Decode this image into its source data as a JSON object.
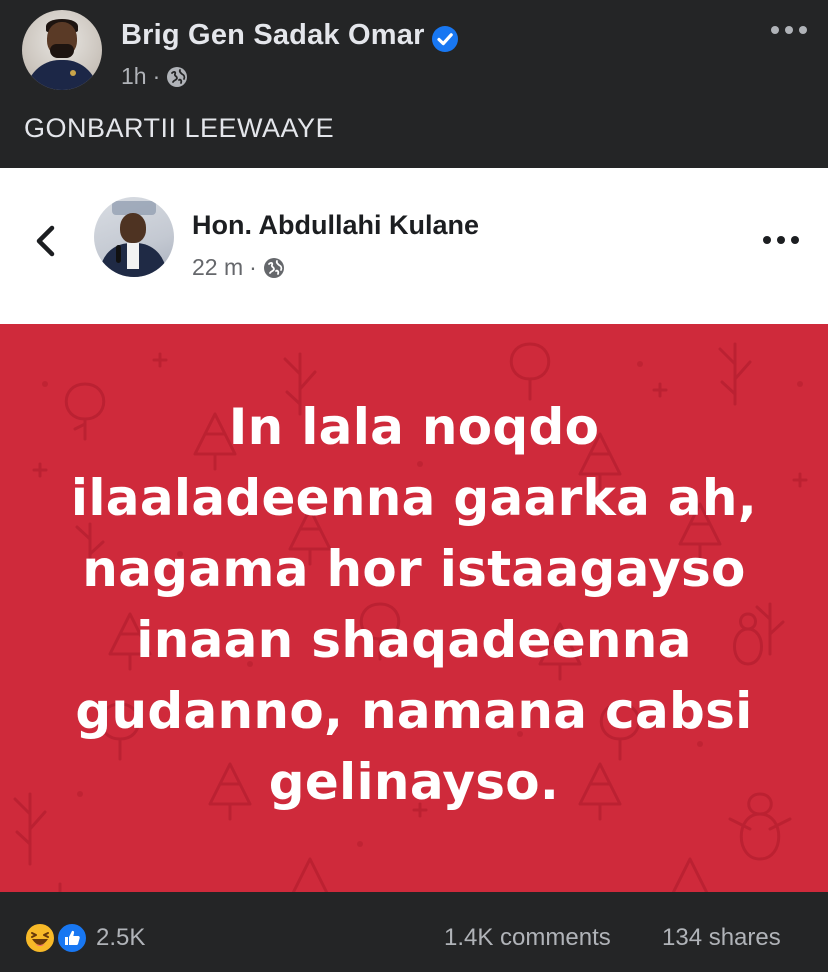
{
  "post": {
    "author_name": "Brig Gen Sadak Omar",
    "time": "1h",
    "separator": "·",
    "caption": "GONBARTII LEEWAAYE"
  },
  "shared_post": {
    "author_name": "Hon. Abdullahi Kulane",
    "time": "22 m",
    "separator": "·",
    "quote_lines": [
      "In lala noqdo",
      "ilaaladeenna gaarka ah,",
      "nagama hor istaagayso",
      "inaan shaqadeenna",
      "gudanno, namana cabsi",
      "gelinayso."
    ]
  },
  "engagement": {
    "reactions": "2.5K",
    "comments": "1.4K comments",
    "shares": "134 shares"
  },
  "icons": {
    "verified": "verified-badge-icon",
    "audience": "globe-icon",
    "more": "more-options-icon",
    "back": "chevron-left-icon",
    "reaction_1": "haha-reaction-icon",
    "reaction_2": "like-reaction-icon"
  },
  "colors": {
    "background": "#242526",
    "primary_text": "#e4e6eb",
    "secondary_text": "#b0b3b8",
    "verified_blue": "#1877f2",
    "quote_card_red": "#cf2a3b",
    "like_blue": "#1877f2",
    "haha_yellow": "#f7b928"
  }
}
